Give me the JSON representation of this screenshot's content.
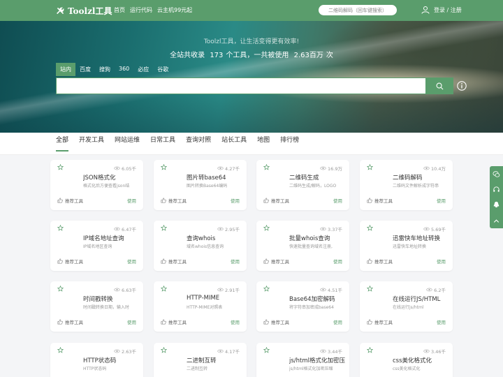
{
  "header": {
    "logo_text": "Toolzl工具",
    "nav": [
      "首页",
      "运行代码",
      "云主机99元起"
    ],
    "search_placeholder": "二维码解码（回车键搜索）",
    "user_label": "登录 / 注册"
  },
  "hero": {
    "slogan": "Toolzl工具，让生活变得更有效率!",
    "stats_prefix": "全站共收录",
    "tool_count": "173",
    "stats_middle": "个工具，一共被使用",
    "usage_count": "2.63百万",
    "stats_suffix": "次",
    "engines": [
      "站内",
      "百度",
      "搜狗",
      "360",
      "必应",
      "谷歌"
    ]
  },
  "categories": [
    "全部",
    "开发工具",
    "网站运维",
    "日常工具",
    "查询对照",
    "站长工具",
    "地图",
    "排行榜"
  ],
  "card_labels": {
    "recommend": "推荐工具",
    "use": "使用"
  },
  "tools": [
    {
      "title": "JSON格式化",
      "desc": "格式化后方便查看json结",
      "views": "6.05千"
    },
    {
      "title": "图片转base64",
      "desc": "图片转换Base64编码",
      "views": "4.27千"
    },
    {
      "title": "二维码生成",
      "desc": "二维码生成/解码，LOGO",
      "views": "16.9万"
    },
    {
      "title": "二维码解码",
      "desc": "二维码文件解析成字符串",
      "views": "10.4万"
    },
    {
      "title": "IP域名地址查询",
      "desc": "IP域名地区查询",
      "views": "6.47千"
    },
    {
      "title": "查询whois",
      "desc": "域名whois信息查询",
      "views": "2.95千"
    },
    {
      "title": "批量whois查询",
      "desc": "快速批量查询域名注册,",
      "views": "3.37千"
    },
    {
      "title": "迅雷快车地址转换",
      "desc": "迅雷快车地址转换",
      "views": "5.69千"
    },
    {
      "title": "时间戳转换",
      "desc": "时间戳转换日期，输入时",
      "views": "6.63千"
    },
    {
      "title": "HTTP-MIME",
      "desc": "HTTP-MIME对照表",
      "views": "2.91千"
    },
    {
      "title": "Base64加密解码",
      "desc": "将字符串加密成base64",
      "views": "4.51千"
    },
    {
      "title": "在线运行JS/HTML",
      "desc": "在线运行js/html",
      "views": "6.2千"
    },
    {
      "title": "HTTP状态码",
      "desc": "HTTP状态码",
      "views": "2.63千"
    },
    {
      "title": "二进制互转",
      "desc": "二进制互转",
      "views": "4.17千"
    },
    {
      "title": "js/html格式化加密压缩",
      "desc": "js/html格式化加密压缩",
      "views": "3.44千"
    },
    {
      "title": "css美化格式化",
      "desc": "css美化格式化",
      "views": "3.46千"
    }
  ],
  "colors": {
    "accent": "#5a9d6c"
  }
}
